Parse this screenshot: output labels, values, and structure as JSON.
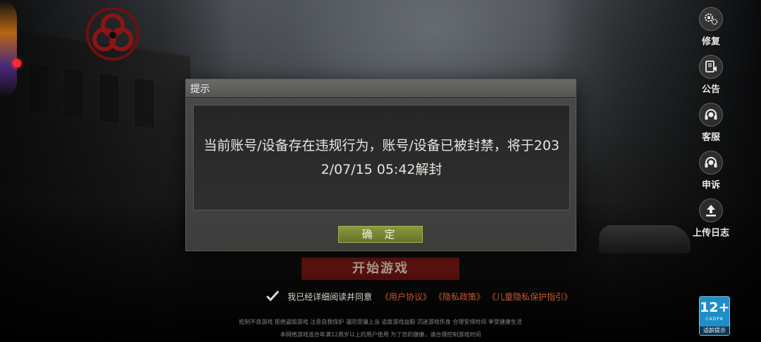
{
  "side_menu": {
    "items": [
      {
        "label": "修复",
        "icon": "gears-icon"
      },
      {
        "label": "公告",
        "icon": "announcement-icon"
      },
      {
        "label": "客服",
        "icon": "headset-icon"
      },
      {
        "label": "申诉",
        "icon": "appeal-headset-icon"
      },
      {
        "label": "上传日志",
        "icon": "upload-icon"
      }
    ]
  },
  "dialog": {
    "title": "提示",
    "message": "当前账号/设备存在违规行为，账号/设备已被封禁，将于2032/07/15 05:42解封",
    "confirm_label": "确 定"
  },
  "start_button": {
    "label": "开始游戏"
  },
  "agreement": {
    "text": "我已经详细阅读并同意",
    "links": [
      "《用户协议》",
      "《隐私政策》",
      "《儿童隐私保护指引》"
    ],
    "checked": true
  },
  "notice": {
    "line1": "抵制不良游戏  拒绝盗版游戏  注意自我保护  谨防受骗上当  适度游戏益脑  沉迷游戏伤身  合理安排时间  享受健康生活",
    "line2": "本网络游戏适合年满12周岁以上的用户使用    为了您的健康，请合理控制游戏时间"
  },
  "age_rating": {
    "value": "12+",
    "org": "CADPA",
    "tip": "适龄提示"
  },
  "colors": {
    "confirm_button": "#7a8a34",
    "start_button": "#7a1712",
    "link": "#c8562a",
    "age_badge": "#1f8dc8"
  }
}
